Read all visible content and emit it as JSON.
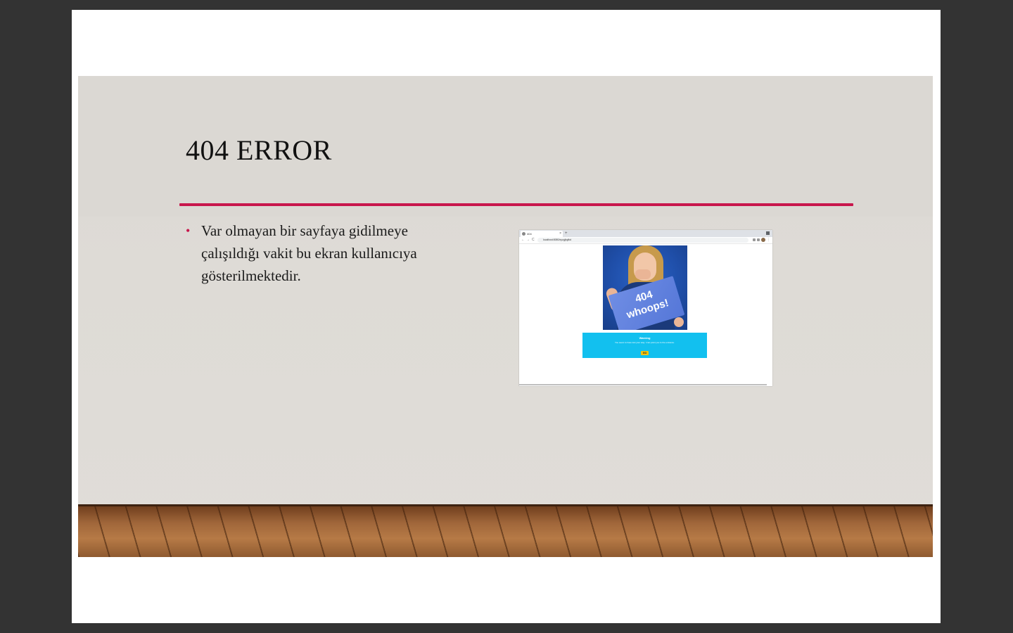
{
  "slide": {
    "title": "404 ERROR",
    "accent_color": "#c8174c",
    "bullets": [
      {
        "marker": "•",
        "text": "Var olmayan bir sayfaya gidilmeye çalışıldığı vakit bu ekran kullanıcıya gösterilmektedir."
      }
    ]
  },
  "embedded_screenshot": {
    "tab_title": "404",
    "tab_close": "×",
    "new_tab": "+",
    "nav_back": "←",
    "nav_forward": "→",
    "nav_reload": "C",
    "address": "localhost:8080/xyzgjhgfkd",
    "menu": "⋮",
    "hero_text_line1": "404",
    "hero_text_line2": "whoops!",
    "warning_title": "Warning",
    "warning_message": "You seem to have lost your way. I can point you to the entrance.",
    "warning_button": "GO",
    "warning_color": "#12c0ef",
    "button_color": "#f4c20d"
  }
}
